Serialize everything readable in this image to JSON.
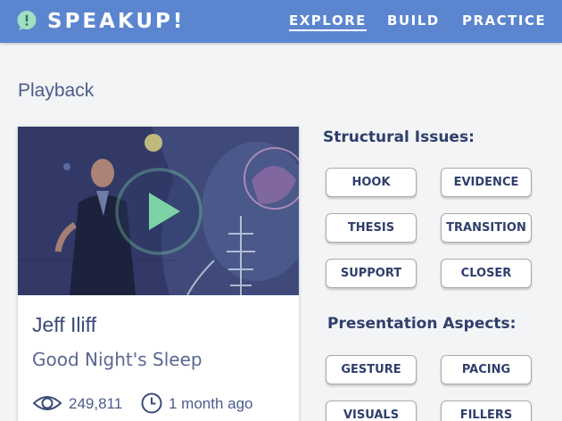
{
  "header": {
    "brand": "SPEAKUP!",
    "logo_icon": "speech-bubble-exclamation-icon",
    "nav": [
      {
        "label": "EXPLORE",
        "active": true
      },
      {
        "label": "BUILD",
        "active": false
      },
      {
        "label": "PRACTICE",
        "active": false
      }
    ]
  },
  "page": {
    "title": "Playback"
  },
  "video_card": {
    "speaker": "Jeff Iliff",
    "talk_title": "Good Night's Sleep",
    "views": "249,811",
    "posted": "1 month ago",
    "play_icon": "play-icon",
    "views_icon": "eye-icon",
    "time_icon": "clock-icon"
  },
  "structural": {
    "title": "Structural Issues:",
    "tags": [
      "HOOK",
      "EVIDENCE",
      "THESIS",
      "TRANSITION",
      "SUPPORT",
      "CLOSER"
    ]
  },
  "presentation": {
    "title": "Presentation Aspects:",
    "tags": [
      "GESTURE",
      "PACING",
      "VISUALS",
      "FILLERS"
    ]
  },
  "colors": {
    "header": "#5b86cf",
    "play_circle": "#7bd3a6",
    "heading_text": "#2f3f6c"
  }
}
